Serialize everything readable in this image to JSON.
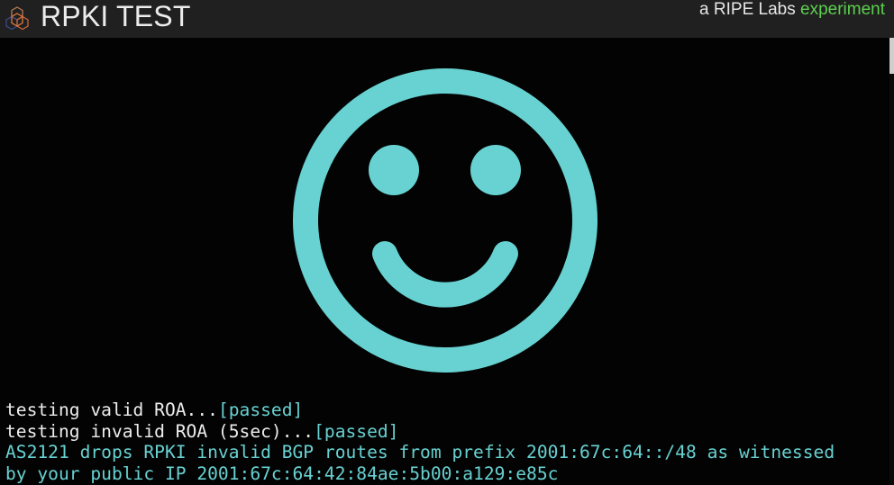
{
  "header": {
    "logo_icon": "ripe-hexagon-logo-icon",
    "title": "RPKI TEST",
    "tagline_prefix": "a RIPE Labs",
    "tagline_accent": "experiment"
  },
  "result": {
    "icon": "smiley-face-icon",
    "color": "#68d1d1"
  },
  "console": {
    "lines": [
      {
        "text": "testing valid ROA...",
        "status": "[passed]"
      },
      {
        "text": "testing invalid ROA (5sec)...",
        "status": "[passed]"
      }
    ],
    "summary_line1": "AS2121 drops RPKI invalid BGP routes from prefix 2001:67c:64::/48 as witnessed",
    "summary_line2": "by your public IP 2001:67c:64:42:84ae:5b00:a129:e85c"
  },
  "colors": {
    "header_bg": "#202020",
    "page_bg": "#030303",
    "accent_green": "#5ccf4e",
    "accent_teal": "#68d1d1"
  }
}
